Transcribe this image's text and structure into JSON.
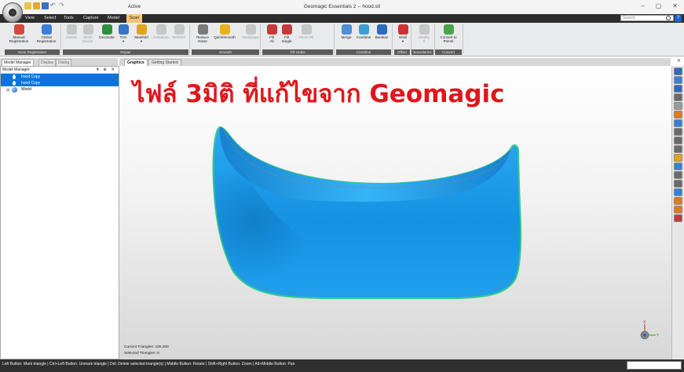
{
  "window": {
    "title": "Geomagic Essentials 2 -- hood.stl",
    "context_tab_label": "Active",
    "controls": [
      "–",
      "▢",
      "✕"
    ]
  },
  "tabs": [
    {
      "label": "View"
    },
    {
      "label": "Select"
    },
    {
      "label": "Tools"
    },
    {
      "label": "Capture"
    },
    {
      "label": "Model"
    },
    {
      "label": "Scan"
    }
  ],
  "search": {
    "placeholder": "Search"
  },
  "help_label": "?",
  "ribbon": {
    "groups": [
      {
        "label": "Scan Registration"
      },
      {
        "label": "Repair"
      },
      {
        "label": "Smooth"
      },
      {
        "label": "Fill Holes"
      },
      {
        "label": "Combine"
      },
      {
        "label": "Offset"
      },
      {
        "label": "Boundaries"
      },
      {
        "label": "Convert"
      }
    ],
    "buttons": [
      {
        "label": "Manual\nRegistration",
        "enabled": true,
        "color": "#d24a3a"
      },
      {
        "label": "Global\nRegistration",
        "enabled": true,
        "color": "#3b7fd4"
      },
      {
        "label": "Delete",
        "enabled": false,
        "color": "#a8a8a8"
      },
      {
        "label": "Mesh\nDoctor",
        "enabled": false,
        "color": "#a8a8a8"
      },
      {
        "label": "Decimate",
        "enabled": true,
        "color": "#2d8e3c"
      },
      {
        "label": "Trim\n▾",
        "enabled": true,
        "color": "#3673c9"
      },
      {
        "label": "Manifold\n▾",
        "enabled": true,
        "color": "#e0a31e"
      },
      {
        "label": "Defeature",
        "enabled": false,
        "color": "#a8a8a8"
      },
      {
        "label": "Refresh",
        "enabled": false,
        "color": "#a8a8a8"
      },
      {
        "label": "Reduce\nNoise",
        "enabled": true,
        "color": "#7a7a7a"
      },
      {
        "label": "QuickSmooth",
        "enabled": true,
        "color": "#e6b31c"
      },
      {
        "label": "Sandpaper",
        "enabled": false,
        "color": "#a8a8a8"
      },
      {
        "label": "Fill\nAll",
        "enabled": true,
        "color": "#c43a3a"
      },
      {
        "label": "Fill\nSingle",
        "enabled": true,
        "color": "#c43a3a"
      },
      {
        "label": "Show Fill",
        "enabled": false,
        "color": "#a8a8a8"
      },
      {
        "label": "Merge",
        "enabled": true,
        "color": "#4f8fd6"
      },
      {
        "label": "Combine",
        "enabled": true,
        "color": "#3aa0d0"
      },
      {
        "label": "Boolean",
        "enabled": true,
        "color": "#2f6ac0"
      },
      {
        "label": "Shell\n▾",
        "enabled": true,
        "color": "#d03030"
      },
      {
        "label": "Modify\n▾",
        "enabled": false,
        "color": "#a8a8a8"
      },
      {
        "label": "Convert to\nPoints",
        "enabled": true,
        "color": "#4aa54a"
      }
    ]
  },
  "left_panel": {
    "tabs": [
      {
        "label": "Model Manager"
      },
      {
        "label": "Display"
      },
      {
        "label": "Dialog"
      }
    ],
    "header": "Model Manager",
    "header_controls": "▾ ⊕ ✕",
    "tree": [
      {
        "label": "hood Copy",
        "selected": true
      },
      {
        "label": "hood Copy",
        "selected": true
      },
      {
        "label": "World",
        "selected": false
      }
    ]
  },
  "viewport": {
    "tabs": [
      {
        "label": "Graphics"
      },
      {
        "label": "Getting Started"
      }
    ],
    "overlay_title": "ไฟล์ 3มิติ ที่แก้ไขจาก Geomagic",
    "stats": {
      "current_triangles": "Current Triangles: 100,309",
      "selected_triangles": "Selected Triangles: 0"
    },
    "model_color": "#21a4ee",
    "model_edge_color": "#37c98c",
    "triad": {
      "x_label": "X",
      "y_label": "Y"
    }
  },
  "right_toolbar": {
    "colors": [
      "#2f6ac0",
      "#3b7fd4",
      "#2f6ac0",
      "#6a6a6a",
      "#9a9a9a",
      "#e07a1e",
      "#3b7fd4",
      "#6a6a6a",
      "#6a6a6a",
      "#6a6a6a",
      "#e0a31e",
      "#3b7fd4",
      "#6a6a6a",
      "#6a6a6a",
      "#3b7fd4",
      "#e07a1e",
      "#e07a1e",
      "#c43a3a"
    ]
  },
  "status_bar": {
    "text": "Left Button: Mark triangle | Ctrl+Left Button: Unmark triangle | Del: Delete selected triangle(s) | Middle Button: Rotate | Shift+Right Button: Zoom | Alt+Middle Button: Pan"
  }
}
